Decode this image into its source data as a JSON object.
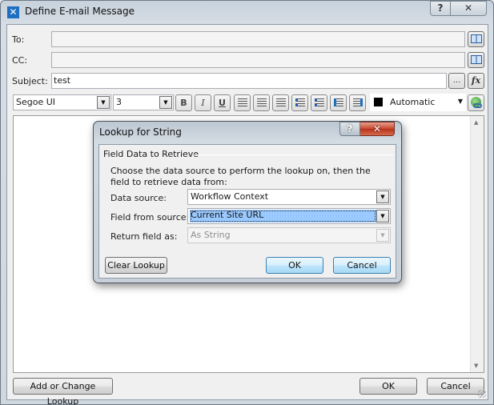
{
  "window": {
    "title": "Define E-mail Message",
    "help_button": "?",
    "close_button": "✕"
  },
  "form": {
    "to_label": "To:",
    "to_value": "",
    "cc_label": "CC:",
    "cc_value": "",
    "subject_label": "Subject:",
    "subject_value": "test",
    "subject_browse": "...",
    "subject_formula": "fx"
  },
  "toolbar": {
    "font": "Segoe UI",
    "size": "3",
    "bold": "B",
    "italic": "I",
    "underline": "U",
    "font_color_label": "Automatic",
    "font_color": "#000000"
  },
  "footer": {
    "add_lookup": "Add or Change Lookup",
    "ok": "OK",
    "cancel": "Cancel"
  },
  "dialog": {
    "title": "Lookup for String",
    "help_button": "?",
    "close_button": "✕",
    "group_title": "Field Data to Retrieve",
    "description": "Choose the data source to perform the lookup on, then the field to retrieve data from:",
    "data_source_label": "Data source:",
    "data_source_value": "Workflow Context",
    "field_label": "Field from source:",
    "field_value": "Current Site URL",
    "return_label": "Return field as:",
    "return_value": "As String",
    "clear_lookup": "Clear Lookup",
    "ok": "OK",
    "cancel": "Cancel"
  },
  "icons": {
    "dropdown": "▼",
    "scroll_up": "▲",
    "scroll_down": "▼"
  }
}
